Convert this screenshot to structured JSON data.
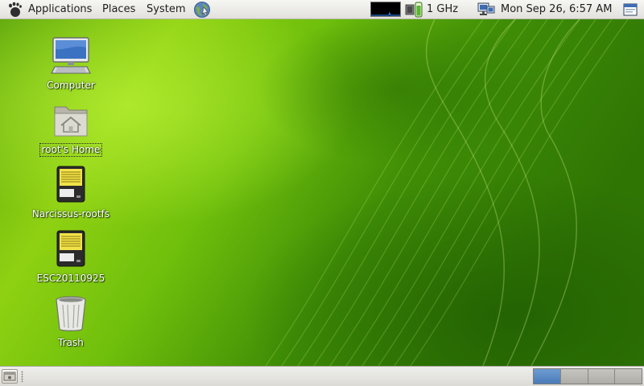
{
  "top_panel": {
    "menus": {
      "applications": "Applications",
      "places": "Places",
      "system": "System"
    },
    "cpufreq_label": "1 GHz",
    "clock": "Mon Sep 26,  6:57 AM"
  },
  "desktop": {
    "icons": [
      {
        "label": "Computer",
        "icon": "computer-icon"
      },
      {
        "label": "root's Home",
        "icon": "home-folder-icon"
      },
      {
        "label": "Narcissus-rootfs",
        "icon": "drive-icon"
      },
      {
        "label": "ESC20110925",
        "icon": "drive-icon"
      },
      {
        "label": "Trash",
        "icon": "trash-icon"
      }
    ],
    "selected_icon": "root's Home"
  },
  "bottom_panel": {
    "workspaces": [
      "1",
      "2",
      "3",
      "4"
    ],
    "active_workspace": "1"
  },
  "colors": {
    "panel": "#e8e7e3",
    "desktop_green": "#4f9e0b",
    "workspace_active": "#5a8ac6"
  }
}
